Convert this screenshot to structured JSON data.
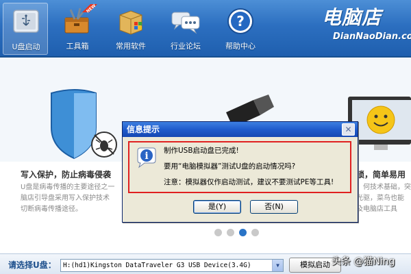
{
  "toolbar": {
    "items": [
      {
        "label": "U盘启动",
        "icon": "usb-drive-icon"
      },
      {
        "label": "工具箱",
        "icon": "toolbox-icon",
        "badge": "NEW"
      },
      {
        "label": "常用软件",
        "icon": "software-box-icon"
      },
      {
        "label": "行业论坛",
        "icon": "forum-chat-icon"
      },
      {
        "label": "帮助中心",
        "icon": "help-icon"
      }
    ]
  },
  "logo": {
    "main": "电脑店",
    "sub": "DianNaoDian.com"
  },
  "banner": {
    "left_title": "写入保护，防止病毒侵袭",
    "left_text": [
      "U盘是病毒传播的主要途径之一",
      "脑店引导盘采用写入保护技术",
      "切断病毒传播途径。"
    ],
    "right_title": "锁，简单易用",
    "right_text": [
      "，何技术基础，突",
      "光驱，菜鸟也能",
      "及电脑店工具"
    ],
    "dots": 4,
    "active_dot": 2
  },
  "dialog": {
    "title": "信息提示",
    "close": "✕",
    "line1": "制作USB启动盘已完成!",
    "line2": "要用“电脑模拟器”测试U盘的启动情况吗?",
    "line3": "注意：模拟器仅作启动测试，建议不要测试PE等工具!",
    "yes_label": "是(Y)",
    "no_label": "否(N)"
  },
  "bottom": {
    "select_label": "请选择U盘：",
    "selected_drive": "H:(hd1)Kingston DataTraveler G3 USB Device(3.4G)",
    "arrow": "▼",
    "simulate_label": "模拟启动"
  },
  "watermark": "头条 @猫Ning",
  "colors": {
    "toolbar": "#2c6fc0",
    "dialog_title": "#1f5bcc",
    "highlight_border": "#e02020",
    "dot_active": "#2a74c7"
  }
}
